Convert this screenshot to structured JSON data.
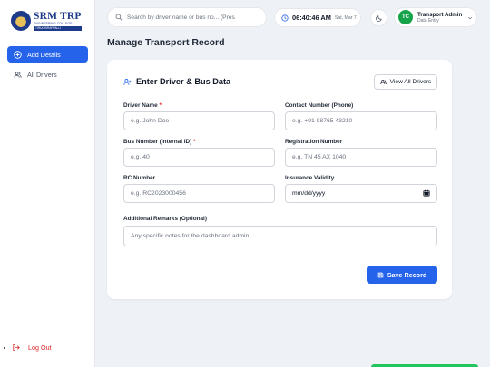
{
  "sidebar": {
    "logo": {
      "title": "SRM TRP",
      "subtitle": "ENGINEERING COLLEGE",
      "band": "TIRUCHIRAPPALLI"
    },
    "items": [
      {
        "label": "Add Details",
        "icon": "plus-circle-icon",
        "active": true
      },
      {
        "label": "All Drivers",
        "icon": "users-icon",
        "active": false
      }
    ],
    "logout_label": "Log Out"
  },
  "header": {
    "search_placeholder": "Search by driver name or bus no... (Pres",
    "time": "06:40:46 AM",
    "date": "Sat, Mar 7",
    "user": {
      "initials": "TC",
      "name": "Transport Admin",
      "role": "Data Entry"
    }
  },
  "page": {
    "title": "Manage Transport Record"
  },
  "form": {
    "title": "Enter Driver & Bus Data",
    "view_all_label": "View All Drivers",
    "fields": {
      "driver_name": {
        "label": "Driver Name",
        "required": "*",
        "placeholder": "e.g. John Doe"
      },
      "contact": {
        "label": "Contact Number (Phone)",
        "placeholder": "e.g. +91 98765 43210"
      },
      "bus_number": {
        "label": "Bus Number (Internal ID)",
        "required": "*",
        "placeholder": "e.g. 40"
      },
      "registration": {
        "label": "Registration Number",
        "placeholder": "e.g. TN 45 AX 1040"
      },
      "rc_number": {
        "label": "RC Number",
        "placeholder": "e.g. RC2023000456"
      },
      "insurance": {
        "label": "Insurance Validity",
        "value": "mm/dd/yyyy"
      },
      "remarks": {
        "label": "Additional Remarks (Optional)",
        "placeholder": "Any specific notes for the dashboard admin..."
      }
    },
    "save_label": "Save Record"
  },
  "colors": {
    "accent": "#2563eb",
    "danger": "#dc2626",
    "avatar": "#16a34a",
    "background": "#eef1f6"
  }
}
